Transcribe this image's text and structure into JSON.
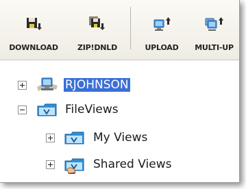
{
  "toolbar": {
    "buttons": [
      {
        "label": "DOWNLOAD",
        "icon": "floppy-download-icon"
      },
      {
        "label": "ZIP!DNLD",
        "icon": "zip-download-icon"
      },
      {
        "label": "UPLOAD",
        "icon": "upload-computer-icon"
      },
      {
        "label": "MULTI-UP",
        "icon": "multi-upload-computer-icon"
      }
    ]
  },
  "tree": {
    "root": {
      "label": "RJOHNSON",
      "icon": "network-computer-icon",
      "expanded": false,
      "selected": true
    },
    "fileviews": {
      "label": "FileViews",
      "icon": "fileviews-folder-icon",
      "expanded": true
    },
    "my_views": {
      "label": "My Views",
      "icon": "folder-icon",
      "expanded": false
    },
    "shared_views": {
      "label": "Shared Views",
      "icon": "shared-folder-icon",
      "expanded": false
    }
  },
  "colors": {
    "selection": "#3b6fd6",
    "toolbar_bg": "#f5f3ec",
    "folder_blue": "#2f8fd6"
  }
}
